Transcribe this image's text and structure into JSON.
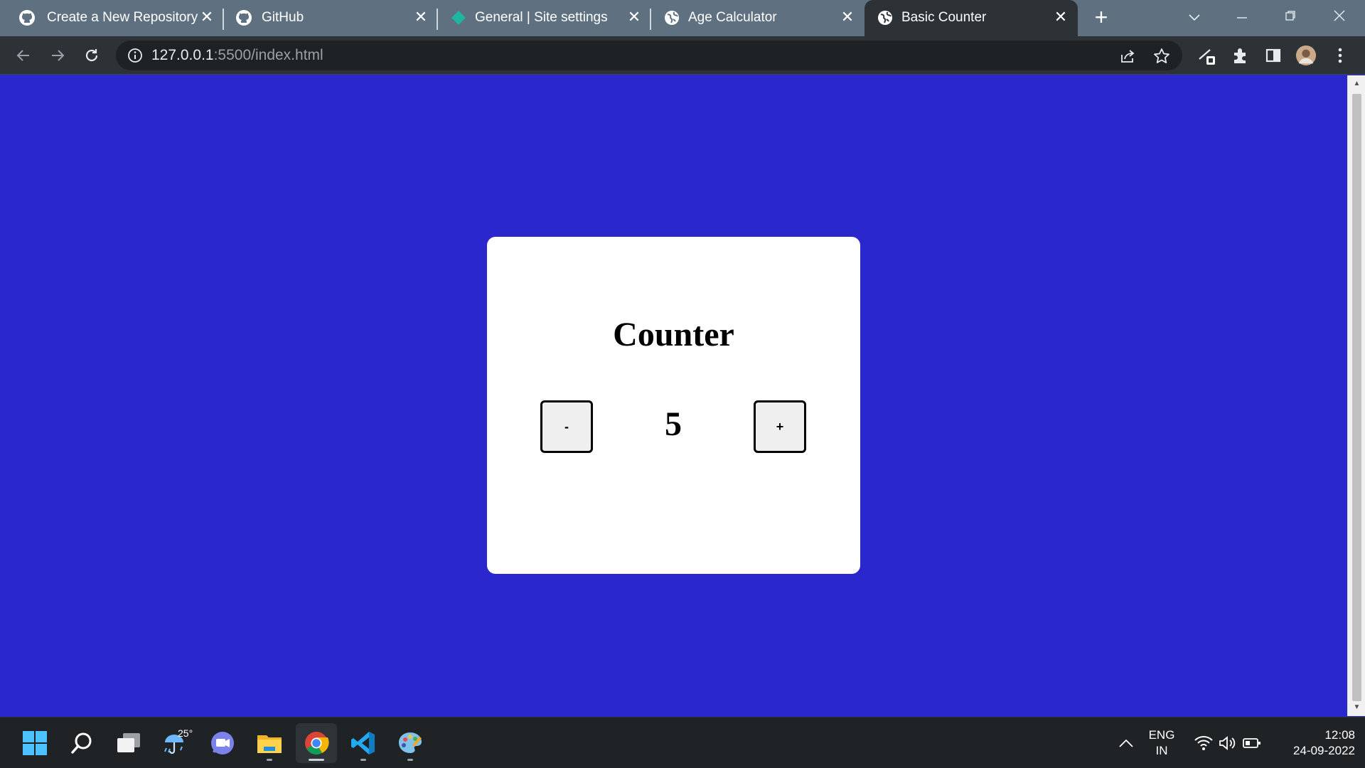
{
  "browser": {
    "tabs": [
      {
        "title": "Create a New Repository",
        "icon": "github-icon"
      },
      {
        "title": "GitHub",
        "icon": "github-icon"
      },
      {
        "title": "General | Site settings",
        "icon": "netlify-icon"
      },
      {
        "title": "Age Calculator",
        "icon": "globe-icon"
      },
      {
        "title": "Basic Counter",
        "icon": "globe-icon",
        "active": true
      }
    ],
    "address": {
      "host": "127.0.0.1",
      "rest": ":5500/index.html"
    }
  },
  "page": {
    "heading": "Counter",
    "decrement_label": "-",
    "increment_label": "+",
    "count": "5",
    "colors": {
      "background": "#2a27cd",
      "card": "#ffffff"
    }
  },
  "taskbar": {
    "weather_temp": "25°",
    "lang_primary": "ENG",
    "lang_region": "IN",
    "time": "12:08",
    "date": "24-09-2022",
    "apps": [
      "start-icon",
      "search-icon",
      "task-view-icon",
      "weather-icon",
      "teams-chat-icon",
      "file-explorer-icon",
      "chrome-icon",
      "vscode-icon",
      "paint-icon"
    ]
  }
}
